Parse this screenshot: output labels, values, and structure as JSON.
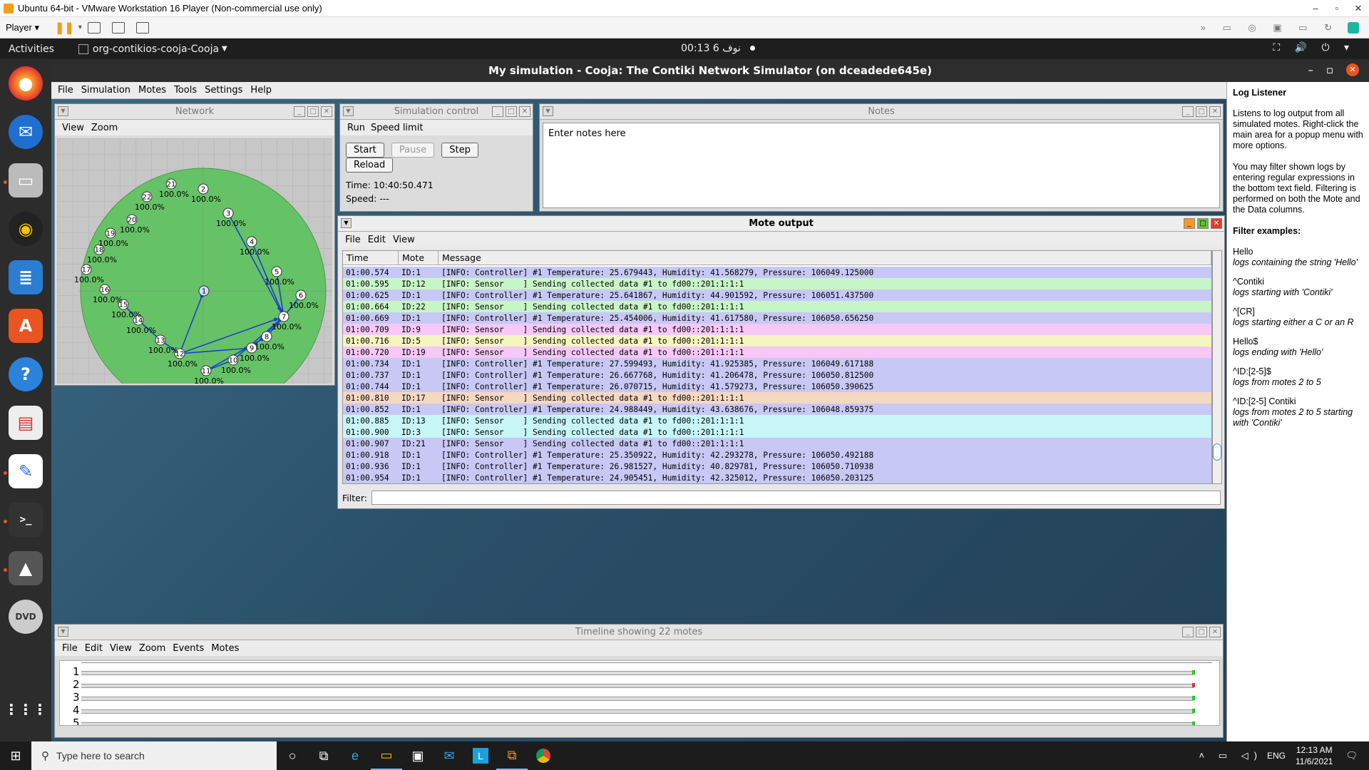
{
  "vm": {
    "title": "Ubuntu 64-bit - VMware Workstation 16 Player (Non-commercial use only)",
    "player_label": "Player"
  },
  "gnome": {
    "activities": "Activities",
    "app_menu": "org-contikios-cooja-Cooja",
    "clock": "00:13  6 نوف"
  },
  "cooja": {
    "title": "My simulation - Cooja: The Contiki Network Simulator (on dceadede645e)",
    "menu": [
      "File",
      "Simulation",
      "Motes",
      "Tools",
      "Settings",
      "Help"
    ]
  },
  "network": {
    "title": "Network",
    "menu": [
      "View",
      "Zoom"
    ],
    "nodes": [
      {
        "id": "1",
        "label": ""
      },
      {
        "id": "2",
        "label": "100.0%"
      },
      {
        "id": "3",
        "label": "100.0%"
      },
      {
        "id": "4",
        "label": "100.0%"
      },
      {
        "id": "5",
        "label": "100.0%"
      },
      {
        "id": "6",
        "label": "100.0%"
      },
      {
        "id": "7",
        "label": "100.0%"
      },
      {
        "id": "8",
        "label": "100.0%"
      },
      {
        "id": "9",
        "label": "100.0%"
      },
      {
        "id": "10",
        "label": "100.0%"
      },
      {
        "id": "11",
        "label": "100.0%"
      },
      {
        "id": "12",
        "label": "100.0%"
      },
      {
        "id": "13",
        "label": "100.0%"
      },
      {
        "id": "14",
        "label": "100.0%"
      },
      {
        "id": "15",
        "label": "100.0%"
      },
      {
        "id": "16",
        "label": "100.0%"
      },
      {
        "id": "17",
        "label": "100.0%"
      },
      {
        "id": "18",
        "label": "100.0%"
      },
      {
        "id": "19",
        "label": "100.0%"
      },
      {
        "id": "20",
        "label": "100.0%"
      },
      {
        "id": "21",
        "label": "100.0%"
      },
      {
        "id": "22",
        "label": "100.0%"
      }
    ]
  },
  "simcontrol": {
    "title": "Simulation control",
    "menu": [
      "Run",
      "Speed limit"
    ],
    "buttons": {
      "start": "Start",
      "pause": "Pause",
      "step": "Step",
      "reload": "Reload"
    },
    "time": "Time: 10:40:50.471",
    "speed": "Speed: ---"
  },
  "notes": {
    "title": "Notes",
    "text": "Enter notes here"
  },
  "moteout": {
    "title": "Mote output",
    "menu": [
      "File",
      "Edit",
      "View"
    ],
    "columns": [
      "Time",
      "Mote",
      "Message"
    ],
    "filter_label": "Filter:",
    "rows": [
      {
        "time": "01:00.574",
        "mote": "ID:1",
        "msg": "[INFO: Controller] #1 Temperature: 25.679443, Humidity: 41.568279, Pressure: 106049.125000",
        "color": "#c8c8f5"
      },
      {
        "time": "01:00.595",
        "mote": "ID:12",
        "msg": "[INFO: Sensor    ] Sending collected data #1 to fd00::201:1:1:1",
        "color": "#c8f5c8"
      },
      {
        "time": "01:00.625",
        "mote": "ID:1",
        "msg": "[INFO: Controller] #1 Temperature: 25.641867, Humidity: 44.901592, Pressure: 106051.437500",
        "color": "#c8c8f5"
      },
      {
        "time": "01:00.664",
        "mote": "ID:22",
        "msg": "[INFO: Sensor    ] Sending collected data #1 to fd00::201:1:1:1",
        "color": "#c8f5c8"
      },
      {
        "time": "01:00.669",
        "mote": "ID:1",
        "msg": "[INFO: Controller] #1 Temperature: 25.454006, Humidity: 41.617580, Pressure: 106050.656250",
        "color": "#c8c8f5"
      },
      {
        "time": "01:00.709",
        "mote": "ID:9",
        "msg": "[INFO: Sensor    ] Sending collected data #1 to fd00::201:1:1:1",
        "color": "#f5c8f5"
      },
      {
        "time": "01:00.716",
        "mote": "ID:5",
        "msg": "[INFO: Sensor    ] Sending collected data #1 to fd00::201:1:1:1",
        "color": "#f5f5c0"
      },
      {
        "time": "01:00.720",
        "mote": "ID:19",
        "msg": "[INFO: Sensor    ] Sending collected data #1 to fd00::201:1:1:1",
        "color": "#f5c8f5"
      },
      {
        "time": "01:00.734",
        "mote": "ID:1",
        "msg": "[INFO: Controller] #1 Temperature: 27.599493, Humidity: 41.925385, Pressure: 106049.617188",
        "color": "#c8c8f5"
      },
      {
        "time": "01:00.737",
        "mote": "ID:1",
        "msg": "[INFO: Controller] #1 Temperature: 26.667768, Humidity: 41.206478, Pressure: 106050.812500",
        "color": "#c8c8f5"
      },
      {
        "time": "01:00.744",
        "mote": "ID:1",
        "msg": "[INFO: Controller] #1 Temperature: 26.070715, Humidity: 41.579273, Pressure: 106050.390625",
        "color": "#c8c8f5"
      },
      {
        "time": "01:00.810",
        "mote": "ID:17",
        "msg": "[INFO: Sensor    ] Sending collected data #1 to fd00::201:1:1:1",
        "color": "#f5d8c0"
      },
      {
        "time": "01:00.852",
        "mote": "ID:1",
        "msg": "[INFO: Controller] #1 Temperature: 24.988449, Humidity: 43.638676, Pressure: 106048.859375",
        "color": "#c8c8f5"
      },
      {
        "time": "01:00.885",
        "mote": "ID:13",
        "msg": "[INFO: Sensor    ] Sending collected data #1 to fd00::201:1:1:1",
        "color": "#c8f5f5"
      },
      {
        "time": "01:00.900",
        "mote": "ID:3",
        "msg": "[INFO: Sensor    ] Sending collected data #1 to fd00::201:1:1:1",
        "color": "#c8f5f5"
      },
      {
        "time": "01:00.907",
        "mote": "ID:21",
        "msg": "[INFO: Sensor    ] Sending collected data #1 to fd00::201:1:1:1",
        "color": "#c8c8f5"
      },
      {
        "time": "01:00.918",
        "mote": "ID:1",
        "msg": "[INFO: Controller] #1 Temperature: 25.350922, Humidity: 42.293278, Pressure: 106050.492188",
        "color": "#c8c8f5"
      },
      {
        "time": "01:00.936",
        "mote": "ID:1",
        "msg": "[INFO: Controller] #1 Temperature: 26.981527, Humidity: 40.829781, Pressure: 106050.710938",
        "color": "#c8c8f5"
      },
      {
        "time": "01:00.954",
        "mote": "ID:1",
        "msg": "[INFO: Controller] #1 Temperature: 24.905451, Humidity: 42.325012, Pressure: 106050.203125",
        "color": "#c8c8f5"
      }
    ]
  },
  "loglistener": {
    "title": "Log Listener",
    "desc1": "Listens to log output from all simulated motes. Right-click the main area for a popup menu with more options.",
    "desc2": "You may filter shown logs by entering regular expressions in the bottom text field. Filtering is performed on both the Mote and the Data columns.",
    "examples_title": "Filter examples:",
    "examples": [
      {
        "pattern": "Hello",
        "desc": "logs containing the string 'Hello'"
      },
      {
        "pattern": "^Contiki",
        "desc": "logs starting with 'Contiki'"
      },
      {
        "pattern": "^[CR]",
        "desc": "logs starting either a C or an R"
      },
      {
        "pattern": "Hello$",
        "desc": "logs ending with 'Hello'"
      },
      {
        "pattern": "^ID:[2-5]$",
        "desc": "logs from motes 2 to 5"
      },
      {
        "pattern": "^ID:[2-5] Contiki",
        "desc": "logs from motes 2 to 5 starting with 'Contiki'"
      }
    ]
  },
  "timeline": {
    "title": "Timeline showing 22 motes",
    "menu": [
      "File",
      "Edit",
      "View",
      "Zoom",
      "Events",
      "Motes"
    ],
    "rows": [
      "1",
      "2",
      "3",
      "4",
      "5"
    ]
  },
  "taskbar": {
    "search_placeholder": "Type here to search",
    "lang": "ENG",
    "time": "12:13 AM",
    "date": "11/6/2021"
  }
}
